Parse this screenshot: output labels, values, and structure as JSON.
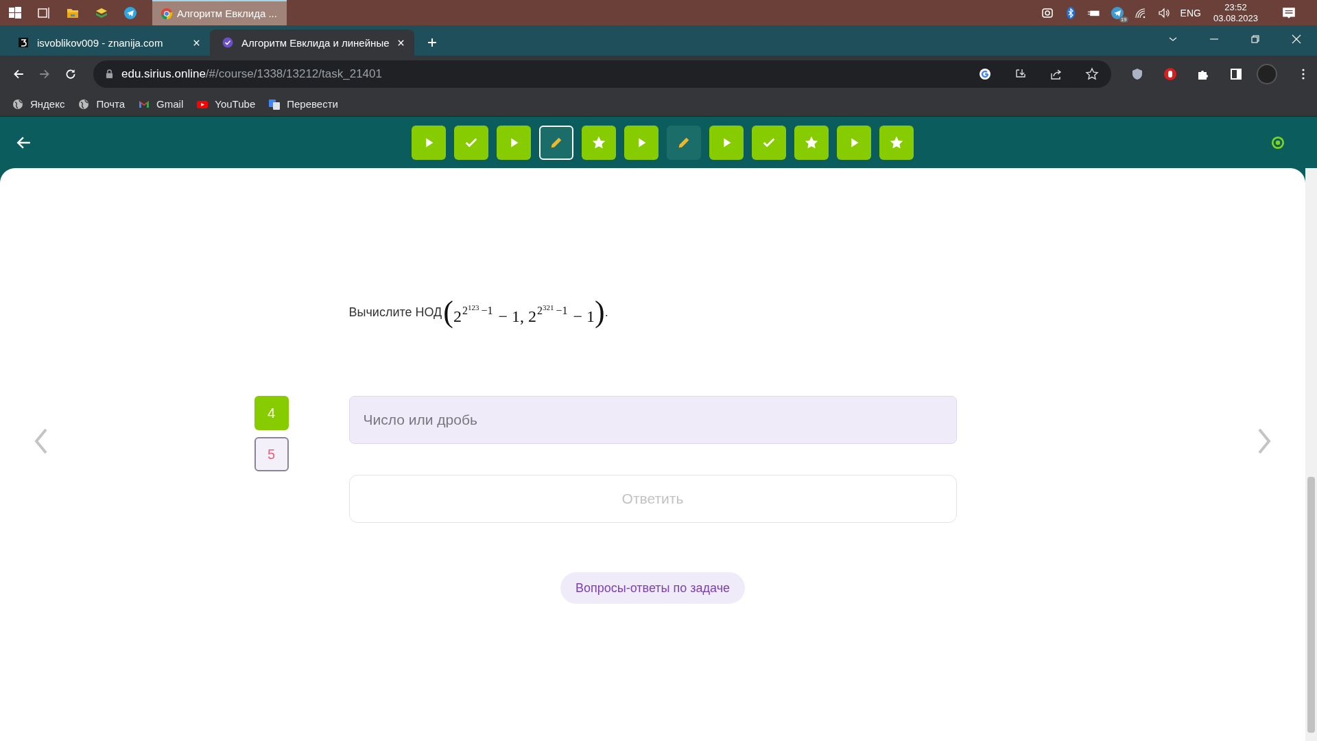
{
  "taskbar": {
    "apps": [
      {
        "kind": "windows"
      },
      {
        "kind": "taskview"
      },
      {
        "kind": "folder"
      },
      {
        "kind": "layers"
      },
      {
        "kind": "telegram"
      }
    ],
    "active_window": {
      "title": "Алгоритм Евклида ..."
    },
    "tray": {
      "language": "ENG",
      "time": "23:52",
      "date": "03.08.2023",
      "telegram_badge": "19"
    }
  },
  "browser": {
    "tabs": [
      {
        "title": "isvoblikov009 - znanija.com",
        "selected": false
      },
      {
        "title": "Алгоритм Евклида и линейные",
        "selected": true
      }
    ],
    "address": {
      "host": "edu.sirius.online",
      "path": "/#/course/1338/13212/task_21401"
    },
    "bookmarks": [
      {
        "label": "Яндекс",
        "kind": "globe"
      },
      {
        "label": "Почта",
        "kind": "globe"
      },
      {
        "label": "Gmail",
        "kind": "mail"
      },
      {
        "label": "YouTube",
        "kind": "video"
      },
      {
        "label": "Перевести",
        "kind": "translate"
      }
    ]
  },
  "task_nav": [
    {
      "kind": "play",
      "solved": true,
      "selected": false
    },
    {
      "kind": "check",
      "solved": true,
      "selected": false
    },
    {
      "kind": "play",
      "solved": true,
      "selected": false
    },
    {
      "kind": "pencil",
      "solved": false,
      "selected": true
    },
    {
      "kind": "star",
      "solved": true,
      "selected": false
    },
    {
      "kind": "play",
      "solved": true,
      "selected": false
    },
    {
      "kind": "pencil",
      "solved": false,
      "selected": false
    },
    {
      "kind": "play",
      "solved": true,
      "selected": false
    },
    {
      "kind": "check",
      "solved": true,
      "selected": false
    },
    {
      "kind": "star",
      "solved": true,
      "selected": false
    },
    {
      "kind": "play",
      "solved": true,
      "selected": false
    },
    {
      "kind": "star",
      "solved": true,
      "selected": false
    }
  ],
  "question": {
    "text": "Вычислите НОД",
    "formula": {
      "open": "(",
      "terms": [
        {
          "base": "2",
          "exponent": "2",
          "exponent_power": "123",
          "exponent_tail": "−1",
          "tail": "− 1"
        },
        {
          "base": "2",
          "exponent": "2",
          "exponent_power": "321",
          "exponent_tail": "−1",
          "tail": "− 1"
        }
      ],
      "separator": ",",
      "close": ")"
    },
    "end": "."
  },
  "attempts": [
    {
      "label": "4",
      "kind": "filled"
    },
    {
      "label": "5",
      "kind": "outlined"
    }
  ],
  "answer": {
    "placeholder": "Число или дробь"
  },
  "submit": {
    "label": "Ответить",
    "disabled": true
  },
  "help_link": "Вопросы-ответы по задаче"
}
